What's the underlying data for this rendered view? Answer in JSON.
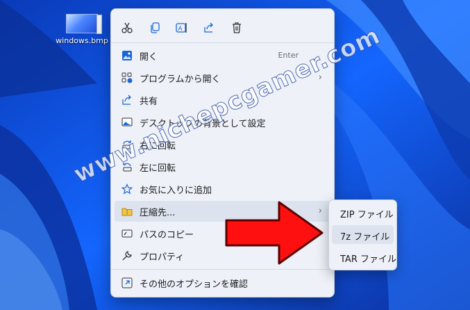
{
  "desktop": {
    "icon_label": "windows.bmp"
  },
  "toolbar": [
    "cut-icon",
    "copy-icon",
    "rename-icon",
    "share-icon",
    "delete-icon"
  ],
  "menu": {
    "items": [
      {
        "label": "開く",
        "shortcut": "Enter"
      },
      {
        "label": "プログラムから開く",
        "arrow": "›"
      },
      {
        "label": "共有"
      },
      {
        "label": "デスクトップの背景として設定"
      },
      {
        "label": "右に回転"
      },
      {
        "label": "左に回転"
      },
      {
        "label": "お気に入りに追加"
      },
      {
        "label": "圧縮先...",
        "arrow": "›"
      },
      {
        "label": "パスのコピー"
      },
      {
        "label": "プロパティ"
      }
    ],
    "more_options": "その他のオプションを確認"
  },
  "submenu": {
    "items": [
      "ZIP ファイル",
      "7z ファイル",
      "TAR ファイル"
    ]
  },
  "watermark": "www.nichepcgamer.com",
  "colors": {
    "arrow_red": "#ff1010",
    "menu_bg": "#eef1f8",
    "accent": "#1a66d9"
  }
}
